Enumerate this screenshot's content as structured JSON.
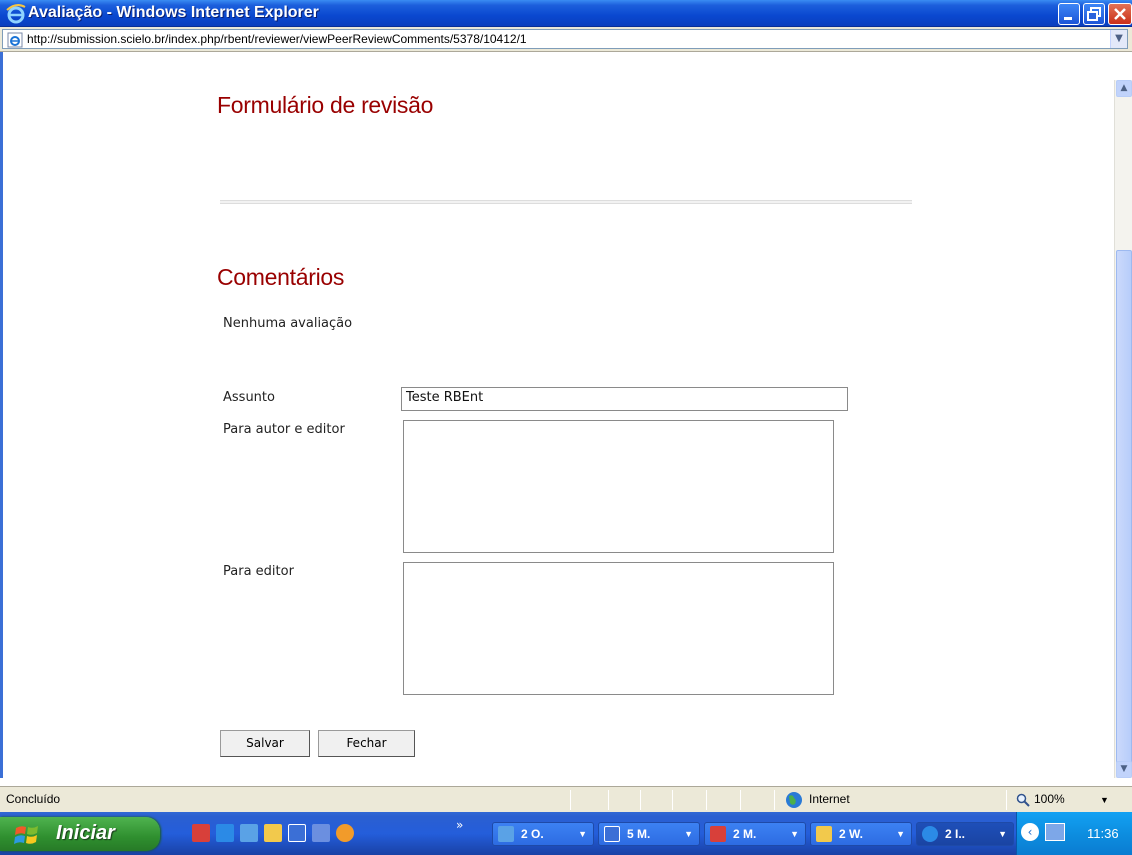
{
  "window": {
    "title": "Avaliação - Windows Internet Explorer",
    "url": "http://submission.scielo.br/index.php/rbent/reviewer/viewPeerReviewComments/5378/10412/1"
  },
  "page": {
    "heading_form": "Formulário de revisão",
    "heading_comments": "Comentários",
    "no_review": "Nenhuma avaliação",
    "subject_label": "Assunto",
    "subject_value": "Teste RBEnt",
    "author_editor_label": "Para autor e editor",
    "author_editor_value": "",
    "editor_label": "Para editor",
    "editor_value": "",
    "save_label": "Salvar",
    "close_label": "Fechar"
  },
  "status": {
    "text": "Concluído",
    "zone": "Internet",
    "zoom": "100%"
  },
  "taskbar": {
    "start_label": "Iniciar",
    "tasks": [
      {
        "label": "2 O."
      },
      {
        "label": "5 M."
      },
      {
        "label": "2 M."
      },
      {
        "label": "2 W."
      },
      {
        "label": "2 I.."
      }
    ],
    "clock": "11:36"
  },
  "colors": {
    "heading": "#990000",
    "titlebar": "#0a48d0",
    "taskbar": "#245edb",
    "start": "#2f8f2f"
  }
}
